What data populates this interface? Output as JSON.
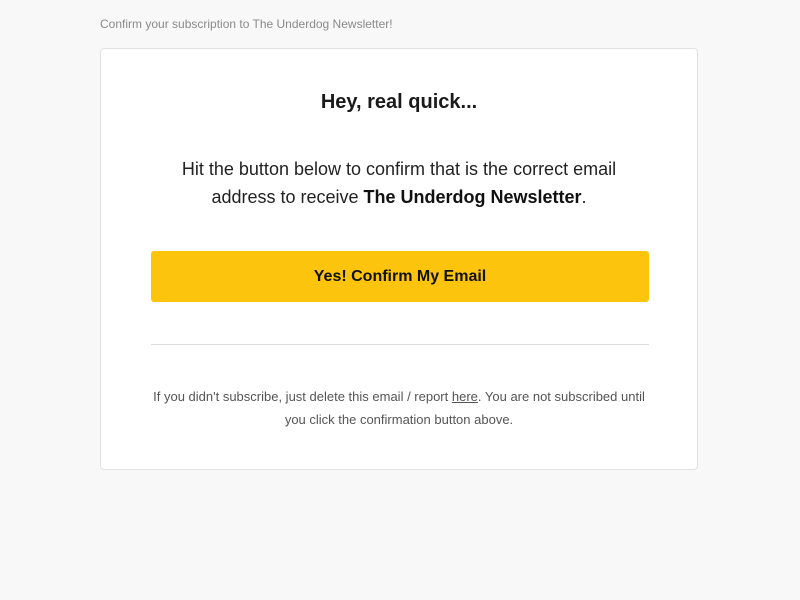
{
  "preheader": "Confirm your subscription to The Underdog Newsletter!",
  "card": {
    "headline": "Hey, real quick...",
    "body": {
      "before": "Hit the button below to confirm that is the correct email address to receive ",
      "newsletter_name": "The Underdog Newsletter",
      "after": "."
    },
    "button_label": "Yes! Confirm My Email",
    "footer": {
      "before": "If you didn't subscribe, just delete this email / report ",
      "link_label": "here",
      "after": ". You are not subscribed until you click the confirmation button above."
    }
  },
  "colors": {
    "button": "#fdc40d",
    "page_background": "#f8f8f8",
    "card_background": "#ffffff"
  }
}
